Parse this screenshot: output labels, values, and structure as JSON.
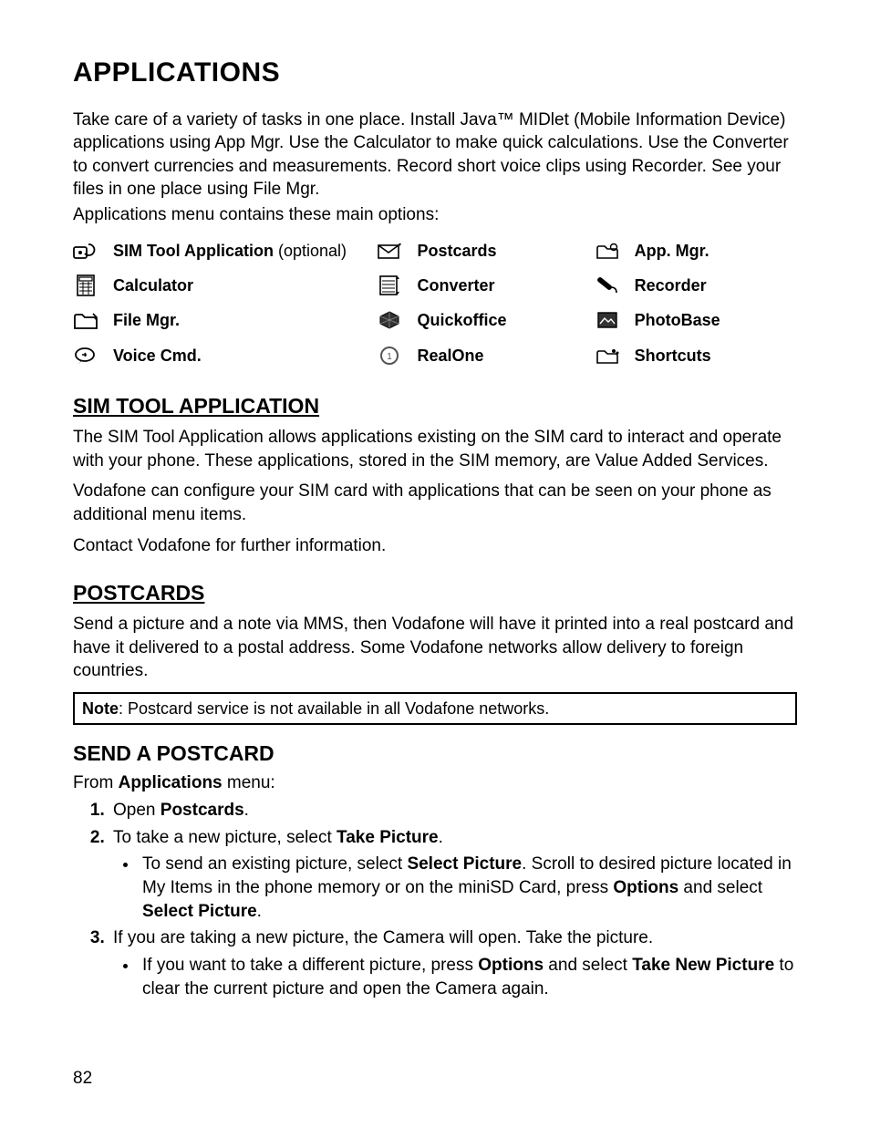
{
  "title": "APPLICATIONS",
  "intro": [
    "Take care of a variety of tasks in one place. Install Java™ MIDlet (Mobile Information Device) applications using App Mgr. Use the Calculator to make quick calculations. Use the Converter to convert currencies and measurements. Record short voice clips using Recorder. See your files in one place using File Mgr.",
    "Applications menu contains these main options:"
  ],
  "apps": {
    "r0c0": {
      "label": "SIM Tool Application",
      "suffix": " (optional)"
    },
    "r0c1": {
      "label": "Postcards"
    },
    "r0c2": {
      "label": "App. Mgr."
    },
    "r1c0": {
      "label": "Calculator"
    },
    "r1c1": {
      "label": "Converter"
    },
    "r1c2": {
      "label": "Recorder"
    },
    "r2c0": {
      "label": "File Mgr."
    },
    "r2c1": {
      "label": "Quickoffice"
    },
    "r2c2": {
      "label": "PhotoBase"
    },
    "r3c0": {
      "label": "Voice Cmd."
    },
    "r3c1": {
      "label": "RealOne"
    },
    "r3c2": {
      "label": "Shortcuts"
    }
  },
  "sim": {
    "heading": "SIM TOOL APPLICATION",
    "p1": "The SIM Tool Application allows applications existing on the SIM card to interact and operate with your phone. These applications, stored in the SIM memory, are Value Added Services.",
    "p2": "Vodafone can configure your SIM card with applications that can be seen on your phone as additional menu items.",
    "p3": "Contact Vodafone for further information."
  },
  "postcards": {
    "heading": "POSTCARDS",
    "p1": "Send a picture and a note via MMS, then Vodafone will have it printed into a real postcard and have it delivered to a postal address. Some Vodafone networks allow delivery to foreign countries.",
    "note_label": "Note",
    "note_text": ": Postcard service is not available in all Vodafone networks."
  },
  "send": {
    "heading": "SEND A POSTCARD",
    "from_a": "From ",
    "from_b": "Applications",
    "from_c": " menu:",
    "s1_a": "Open ",
    "s1_b": "Postcards",
    "s1_c": ".",
    "s2_a": "To take a new picture, select ",
    "s2_b": "Take Picture",
    "s2_c": ".",
    "s2_sub_a": "To send an existing picture, select ",
    "s2_sub_b": "Select Picture",
    "s2_sub_c": ". Scroll to desired picture located in My Items in the phone memory or on the miniSD Card, press ",
    "s2_sub_d": "Options",
    "s2_sub_e": " and select ",
    "s2_sub_f": "Select Picture",
    "s2_sub_g": ".",
    "s3_a": "If you are taking a new picture, the Camera will open. Take the picture.",
    "s3_sub_a": "If you want to take a different picture, press ",
    "s3_sub_b": "Options",
    "s3_sub_c": " and select ",
    "s3_sub_d": "Take New Picture",
    "s3_sub_e": " to clear the current picture and open the Camera again."
  },
  "page_number": "82"
}
